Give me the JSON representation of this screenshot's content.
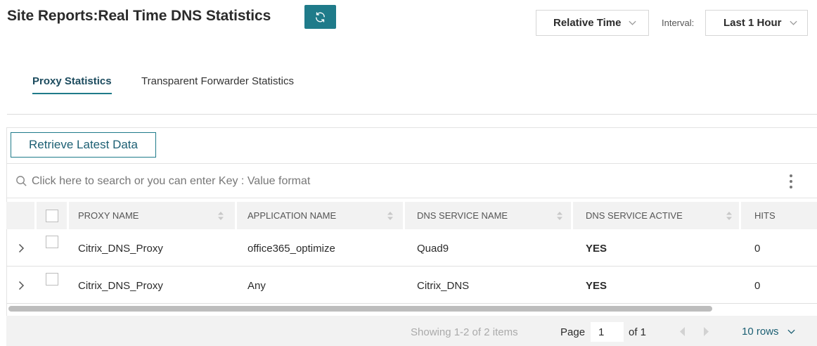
{
  "header": {
    "title": "Site Reports:Real Time DNS Statistics",
    "time_mode": "Relative Time",
    "interval_label": "Interval:",
    "interval_value": "Last 1 Hour"
  },
  "tabs": [
    {
      "label": "Proxy Statistics",
      "active": true
    },
    {
      "label": "Transparent Forwarder Statistics",
      "active": false
    }
  ],
  "toolbar": {
    "retrieve_label": "Retrieve Latest Data"
  },
  "search": {
    "placeholder": "Click here to search or you can enter Key : Value format"
  },
  "table": {
    "columns": [
      "PROXY NAME",
      "APPLICATION NAME",
      "DNS SERVICE NAME",
      "DNS SERVICE ACTIVE",
      "HITS"
    ],
    "rows": [
      {
        "proxy_name": "Citrix_DNS_Proxy",
        "application_name": "office365_optimize",
        "dns_service_name": "Quad9",
        "dns_service_active": "YES",
        "hits": "0"
      },
      {
        "proxy_name": "Citrix_DNS_Proxy",
        "application_name": "Any",
        "dns_service_name": "Citrix_DNS",
        "dns_service_active": "YES",
        "hits": "0"
      }
    ]
  },
  "pagination": {
    "showing": "Showing 1-2 of 2 items",
    "page_label": "Page",
    "page_value": "1",
    "of_label": "of 1",
    "rows_per_page": "10 rows"
  },
  "colors": {
    "accent": "#1f7b8a",
    "header_bg": "#f2f2f2",
    "muted_text": "#aaaaaa"
  },
  "icons": {
    "refresh": "refresh-icon",
    "search": "search-icon",
    "kebab": "kebab-menu-icon",
    "expand": "chevron-right-icon",
    "sort": "sort-icon",
    "dropdown": "chevron-down-icon",
    "prev": "prev-page-icon",
    "next": "next-page-icon"
  }
}
